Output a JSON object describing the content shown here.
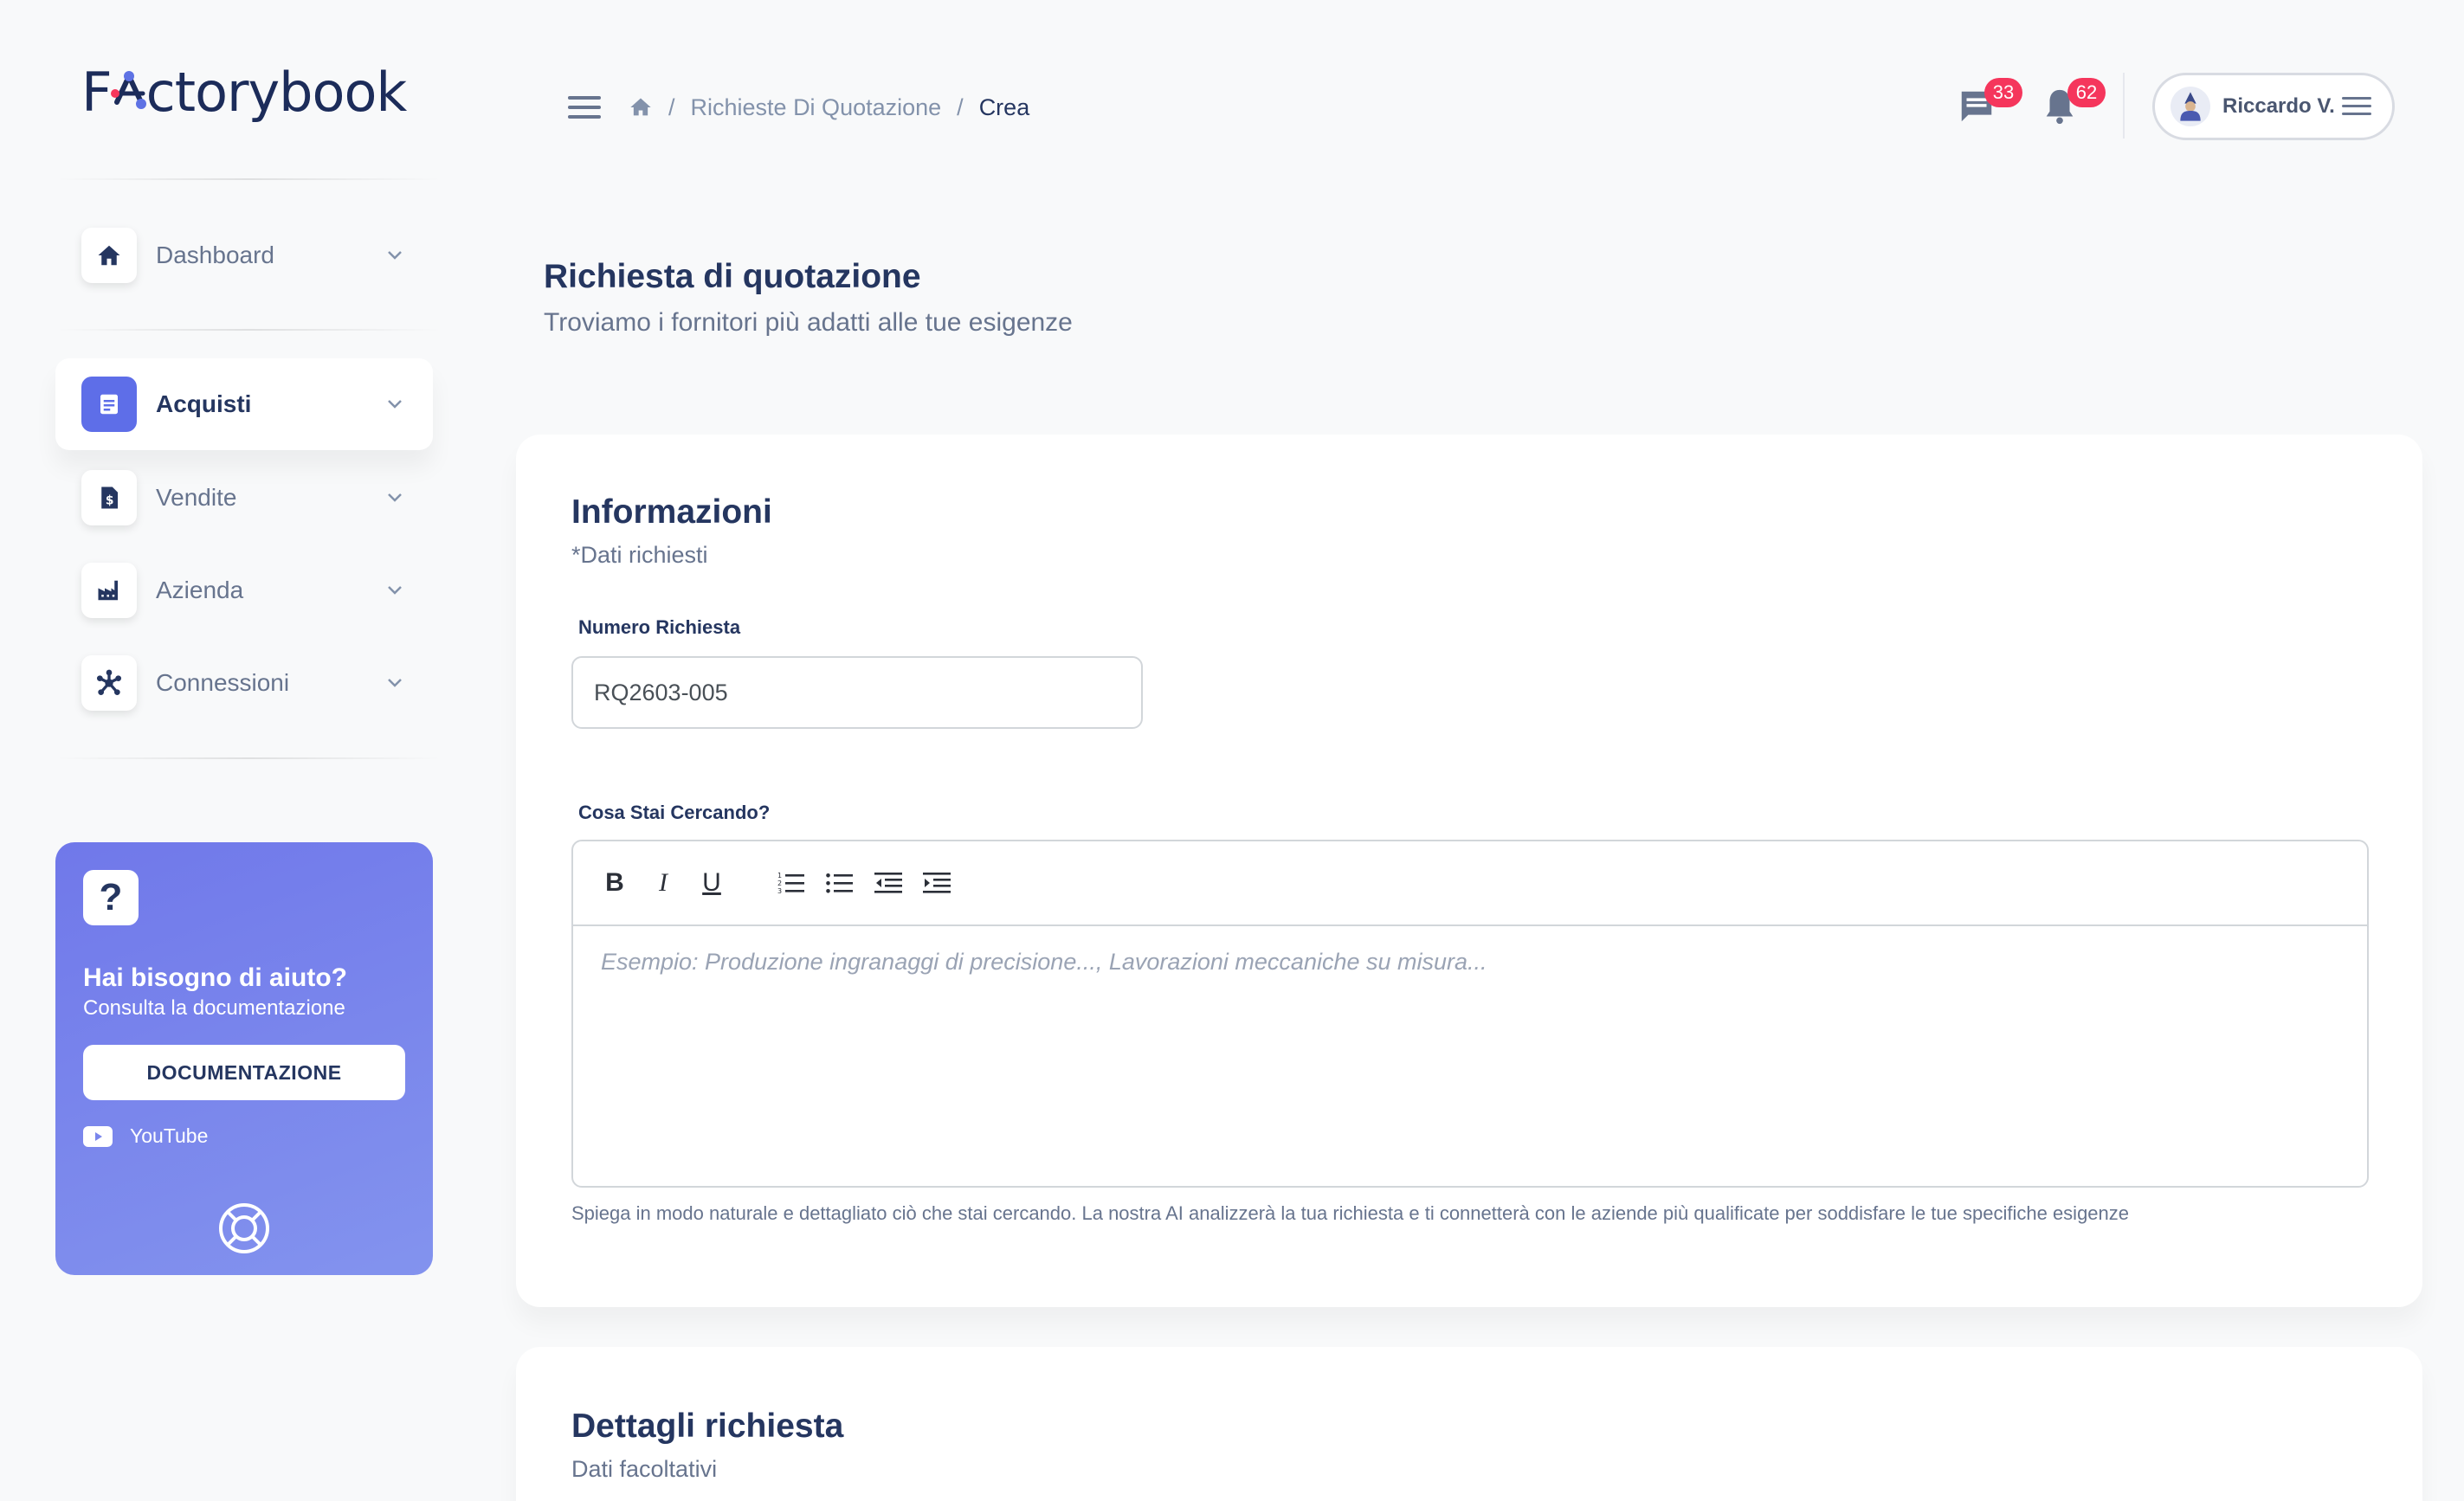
{
  "app": {
    "logo_prefix": "F",
    "logo_suffix": "ctorybook"
  },
  "sidebar": {
    "items": [
      {
        "label": "Dashboard",
        "icon": "home-icon"
      },
      {
        "label": "Acquisti",
        "icon": "document-icon",
        "active": true
      },
      {
        "label": "Vendite",
        "icon": "invoice-icon"
      },
      {
        "label": "Azienda",
        "icon": "factory-icon"
      },
      {
        "label": "Connessioni",
        "icon": "network-icon"
      }
    ],
    "help": {
      "icon_glyph": "?",
      "title": "Hai bisogno di aiuto?",
      "subtitle": "Consulta la documentazione",
      "button": "DOCUMENTAZIONE",
      "youtube": "YouTube"
    }
  },
  "header": {
    "breadcrumb": {
      "section": "Richieste Di Quotazione",
      "separator": "/",
      "current": "Crea"
    },
    "messages_count": "33",
    "notifications_count": "62",
    "user_name": "Riccardo V."
  },
  "main": {
    "title": "Richiesta di quotazione",
    "subtitle": "Troviamo i fornitori più adatti alle tue esigenze",
    "info_card": {
      "title": "Informazioni",
      "subtitle": "*Dati richiesti",
      "numero_label": "Numero Richiesta",
      "numero_value": "RQ2603-005",
      "cerca_label": "Cosa Stai Cercando?",
      "toolbar": {
        "bold": "B",
        "italic": "I",
        "underline": "U"
      },
      "editor_placeholder": "Esempio: Produzione ingranaggi di precisione..., Lavorazioni meccaniche su misura...",
      "help_text": "Spiega in modo naturale e dettagliato ciò che stai cercando. La nostra AI analizzerà la tua richiesta e ti connetterà con le aziende più qualificate per soddisfare le tue specifiche esigenze"
    },
    "details_card": {
      "title": "Dettagli richiesta",
      "subtitle": "Dati facoltativi"
    }
  },
  "colors": {
    "primary": "#5e6ee8",
    "dark": "#253660",
    "badge": "#f5365c",
    "text_muted": "#67748e"
  }
}
